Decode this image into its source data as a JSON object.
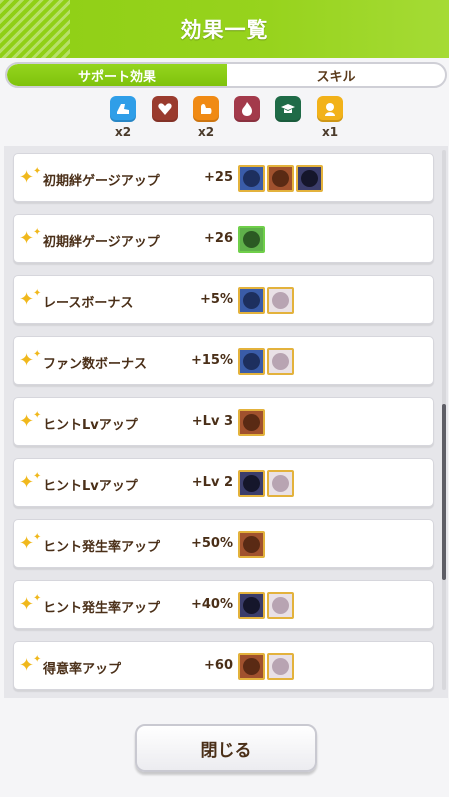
{
  "header": {
    "title": "効果一覧"
  },
  "tabs": [
    {
      "label": "サポート効果",
      "active": true
    },
    {
      "label": "スキル",
      "active": false
    }
  ],
  "types": [
    {
      "icon": "speed-shoe-icon",
      "color": "#2f9ee8",
      "count": "x2"
    },
    {
      "icon": "stamina-heart-icon",
      "color": "#9a3b2e",
      "count": ""
    },
    {
      "icon": "power-arm-icon",
      "color": "#f08a14",
      "count": "x2"
    },
    {
      "icon": "guts-flame-icon",
      "color": "#a33a4b",
      "count": ""
    },
    {
      "icon": "wisdom-cap-icon",
      "color": "#1f6b47",
      "count": ""
    },
    {
      "icon": "friend-face-icon",
      "color": "#f2b21a",
      "count": "x1"
    }
  ],
  "effects": [
    {
      "name": "初期絆ゲージアップ",
      "value": "+25",
      "cards": [
        "blue",
        "brown",
        "dark"
      ]
    },
    {
      "name": "初期絆ゲージアップ",
      "value": "+26",
      "cards": [
        "green"
      ]
    },
    {
      "name": "レースボーナス",
      "value": "+5%",
      "cards": [
        "blue",
        "white"
      ]
    },
    {
      "name": "ファン数ボーナス",
      "value": "+15%",
      "cards": [
        "blue",
        "white"
      ]
    },
    {
      "name": "ヒントLvアップ",
      "value": "+Lv 3",
      "cards": [
        "brown"
      ]
    },
    {
      "name": "ヒントLvアップ",
      "value": "+Lv 2",
      "cards": [
        "dark",
        "white"
      ]
    },
    {
      "name": "ヒント発生率アップ",
      "value": "+50%",
      "cards": [
        "brown"
      ]
    },
    {
      "name": "ヒント発生率アップ",
      "value": "+40%",
      "cards": [
        "dark",
        "white"
      ]
    },
    {
      "name": "得意率アップ",
      "value": "+60",
      "cards": [
        "brown",
        "white"
      ]
    }
  ],
  "footer": {
    "close_label": "閉じる"
  }
}
